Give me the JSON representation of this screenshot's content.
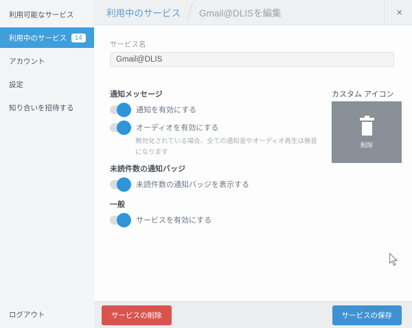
{
  "sidebar": {
    "items": [
      {
        "label": "利用可能なサービス"
      },
      {
        "label": "利用中のサービス",
        "badge": "14",
        "active": true
      },
      {
        "label": "アカウント"
      },
      {
        "label": "設定"
      },
      {
        "label": "知り合いを招待する"
      }
    ],
    "logout": "ログアウト"
  },
  "header": {
    "tab_parent": "利用中のサービス",
    "tab_current": "Gmail@DLISを編集",
    "close_glyph": "×"
  },
  "form": {
    "service_name": {
      "label": "サービス名",
      "value": "Gmail@DLIS"
    },
    "notifications": {
      "heading": "通知メッセージ",
      "toggle_notify": {
        "label": "通知を有効にする",
        "state": "on"
      },
      "toggle_audio": {
        "label": "オーディオを有効にする",
        "state": "on"
      },
      "note": "無効化されている場合、全ての通知音やオーディオ再生は無音になります"
    },
    "badge_section": {
      "heading": "未読件数の通知バッジ",
      "toggle_badge": {
        "label": "未読件数の通知バッジを表示する",
        "state": "on"
      }
    },
    "general": {
      "heading": "一般",
      "toggle_enabled": {
        "label": "サービスを有効にする",
        "state": "on"
      }
    },
    "custom_icon": {
      "heading": "カスタム アイコン",
      "delete_label": "削除"
    }
  },
  "footer": {
    "delete_label": "サービスの削除",
    "save_label": "サービスの保存"
  },
  "colors": {
    "accent_blue": "#3f9edc",
    "toggle_blue": "#2d95d8",
    "danger_red": "#d9534f",
    "save_blue": "#3e92d3",
    "icon_box_gray": "#8a9097",
    "header_bg": "#eef0f2",
    "footer_bg": "#ecedee",
    "sidebar_bg": "#f4f5f6"
  }
}
